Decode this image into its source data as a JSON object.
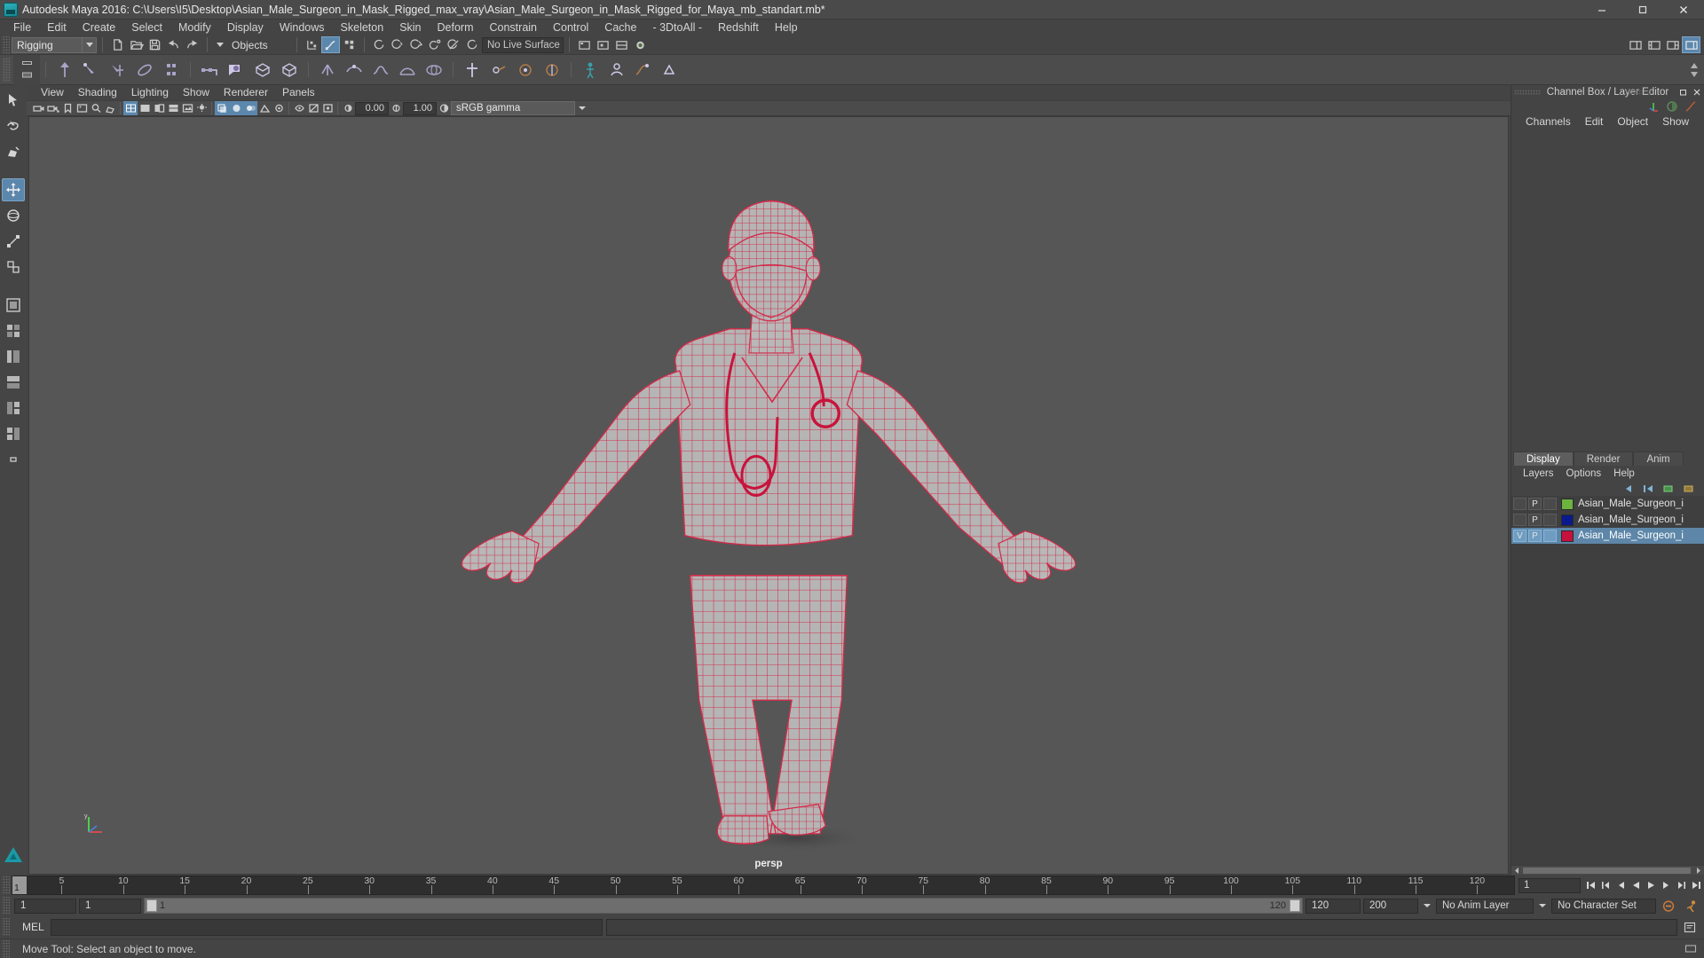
{
  "window": {
    "title": "Autodesk Maya 2016: C:\\Users\\I5\\Desktop\\Asian_Male_Surgeon_in_Mask_Rigged_max_vray\\Asian_Male_Surgeon_in_Mask_Rigged_for_Maya_mb_standart.mb*",
    "app_icon": "maya-icon",
    "minimize_label": "–",
    "maximize_label": "❐",
    "close_label": "✕"
  },
  "menubar": {
    "items": [
      {
        "label": "File"
      },
      {
        "label": "Edit"
      },
      {
        "label": "Create"
      },
      {
        "label": "Select"
      },
      {
        "label": "Modify"
      },
      {
        "label": "Display"
      },
      {
        "label": "Windows"
      },
      {
        "label": "Skeleton"
      },
      {
        "label": "Skin"
      },
      {
        "label": "Deform"
      },
      {
        "label": "Constrain"
      },
      {
        "label": "Control"
      },
      {
        "label": "Cache"
      },
      {
        "label": "- 3DtoAll -"
      },
      {
        "label": "Redshift"
      },
      {
        "label": "Help"
      }
    ]
  },
  "statusline": {
    "menuset": "Rigging",
    "menuset_arrow": "chevron-down-icon",
    "new_scene": "new-scene-icon",
    "open_scene": "open-scene-icon",
    "save_scene": "save-scene-icon",
    "undo": "undo-icon",
    "redo": "redo-icon",
    "selection_mask_arrow": "chevron-down-icon",
    "selection_mask": "Objects",
    "live_surface": "No Live Surface",
    "snap_icons": [
      "snap-grid-icon",
      "snap-curve-icon",
      "snap-point-icon"
    ],
    "magnet_icons": [
      "snap-view-plane-icon",
      "make-live-icon",
      "snap-projected-icon",
      "snap-rotate-icon",
      "snap-disable-icon",
      "snap-arc-icon"
    ],
    "render_icons": [
      "render-current-frame-icon",
      "ipr-render-icon",
      "render-settings-icon",
      "hypershade-icon"
    ],
    "right_icons": [
      "show-hide-editors-icon",
      "attribute-editor-icon",
      "tool-settings-icon",
      "channel-box-icon"
    ]
  },
  "shelf": {
    "tab_icons": [
      "shelf-tab-up-icon",
      "shelf-tab-menu-icon"
    ],
    "items": [
      "skeleton-joint-icon",
      "ik-handle-icon",
      "ik-spline-icon",
      "insert-joint-icon",
      "mirror-joint-icon",
      "bind-skin-icon",
      "paint-weights-icon",
      "interactive-bind-icon",
      "smooth-bind-icon",
      "lattice-icon",
      "cluster-icon",
      "wire-deformer-icon",
      "blendshape-icon",
      "wrap-deformer-icon",
      "parent-constraint-icon",
      "point-constraint-icon",
      "orient-constraint-icon",
      "pole-vector-icon",
      "quick-rig-icon",
      "human-ik-icon",
      "motion-path-icon",
      "set-driven-key-icon"
    ]
  },
  "toolbox": {
    "items": [
      {
        "name": "select-tool-icon",
        "active": false
      },
      {
        "name": "lasso-select-tool-icon",
        "active": false
      },
      {
        "name": "paint-select-tool-icon",
        "active": false
      },
      {
        "name": "move-tool-icon",
        "active": true
      },
      {
        "name": "rotate-tool-icon",
        "active": false
      },
      {
        "name": "scale-tool-icon",
        "active": false
      },
      {
        "name": "last-tool-icon",
        "active": false
      },
      {
        "name": "single-perspective-layout-icon",
        "active": false
      },
      {
        "name": "four-view-layout-icon",
        "active": false
      },
      {
        "name": "persp-outliner-layout-icon",
        "active": false
      },
      {
        "name": "persp-graph-layout-icon",
        "active": false
      },
      {
        "name": "persp-hypershade-layout-icon",
        "active": false
      },
      {
        "name": "two-pane-stacked-layout-icon",
        "active": false
      },
      {
        "name": "layout-more-icon",
        "active": false
      }
    ],
    "logo": "maya-logo-icon"
  },
  "viewport": {
    "panel_menus": [
      {
        "label": "View"
      },
      {
        "label": "Shading"
      },
      {
        "label": "Lighting"
      },
      {
        "label": "Show"
      },
      {
        "label": "Renderer"
      },
      {
        "label": "Panels"
      }
    ],
    "toolbar_icons": [
      "select-camera-icon",
      "camera-attributes-icon",
      "bookmark-icon",
      "image-plane-icon",
      "two-dimensional-pan-zoom-icon",
      "grease-pencil-icon",
      "wireframe-icon",
      "smooth-shade-all-icon",
      "smooth-shade-selected-icon",
      "wireframe-on-shaded-icon",
      "texture-icon",
      "lights-icon",
      "shadows-icon",
      "screen-space-ao-icon",
      "motion-blur-icon",
      "multisample-aa-icon",
      "depth-of-field-icon",
      "isolate-select-icon",
      "xray-icon",
      "xray-joints-icon",
      "exposure-icon",
      "gamma-icon"
    ],
    "exposure_value": "0.00",
    "gamma_value": "1.00",
    "view_transform": "sRGB gamma",
    "view_transform_arrow": "chevron-down-icon",
    "camera_label": "persp",
    "axis_gizmo": "axis-gizmo-icon",
    "background_color": "#565656",
    "wireframe_color": "#d42a49",
    "mesh_color": "#b4b4b4"
  },
  "channelbox": {
    "title": "Channel Box / Layer Editor",
    "restore_label": "❐",
    "close_label": "✕",
    "menus": [
      {
        "label": "Channels"
      },
      {
        "label": "Edit"
      },
      {
        "label": "Object"
      },
      {
        "label": "Show"
      }
    ],
    "icons": [
      "transform-channel-icon",
      "render-channel-icon",
      "anim-channel-icon"
    ]
  },
  "layereditor": {
    "tabs": [
      {
        "label": "Display",
        "active": true
      },
      {
        "label": "Render",
        "active": false
      },
      {
        "label": "Anim",
        "active": false
      }
    ],
    "menus": [
      {
        "label": "Layers"
      },
      {
        "label": "Options"
      },
      {
        "label": "Help"
      }
    ],
    "tool_icons": [
      "layer-prev-icon",
      "layer-prev2-icon",
      "layer-new-icon",
      "layer-new-from-selected-icon"
    ],
    "layers": [
      {
        "visibility": "",
        "playback": "P",
        "type": "",
        "color": "#6cb33f",
        "name": "Asian_Male_Surgeon_i",
        "selected": false
      },
      {
        "visibility": "",
        "playback": "P",
        "type": "",
        "color": "#0a1a8c",
        "name": "Asian_Male_Surgeon_i",
        "selected": false
      },
      {
        "visibility": "V",
        "playback": "P",
        "type": "",
        "color": "#c8103c",
        "name": "Asian_Male_Surgeon_i",
        "selected": true
      }
    ]
  },
  "timeslider": {
    "current_frame": "1",
    "start_tick": 1,
    "end_tick": 122,
    "tick_labels": [
      5,
      10,
      15,
      20,
      25,
      30,
      35,
      40,
      45,
      50,
      55,
      60,
      65,
      70,
      75,
      80,
      85,
      90,
      95,
      100,
      105,
      110,
      115,
      120
    ],
    "frame_field": "1",
    "playback_icons": [
      "go-to-start-icon",
      "step-back-key-icon",
      "step-back-frame-icon",
      "play-backwards-icon",
      "play-forwards-icon",
      "step-forward-frame-icon",
      "step-forward-key-icon",
      "go-to-end-icon"
    ]
  },
  "rangeslider": {
    "anim_start": "1",
    "range_start": "1",
    "bar_start_label": "1",
    "bar_end_label": "120",
    "range_end": "120",
    "anim_end": "200",
    "anim_layer": "No Anim Layer",
    "anim_layer_arrow": "chevron-down-icon",
    "character_set": "No Character Set",
    "character_set_arrow": "chevron-down-icon",
    "auto_key_icon": "auto-keyframe-icon",
    "anim_prefs_icon": "animation-preferences-icon"
  },
  "commandline": {
    "language": "MEL",
    "input_value": "",
    "input_placeholder": "",
    "output_value": "",
    "script_editor_icon": "script-editor-icon"
  },
  "helpline": {
    "text": "Move Tool: Select an object to move.",
    "progress_icon": "help-progress-icon"
  }
}
